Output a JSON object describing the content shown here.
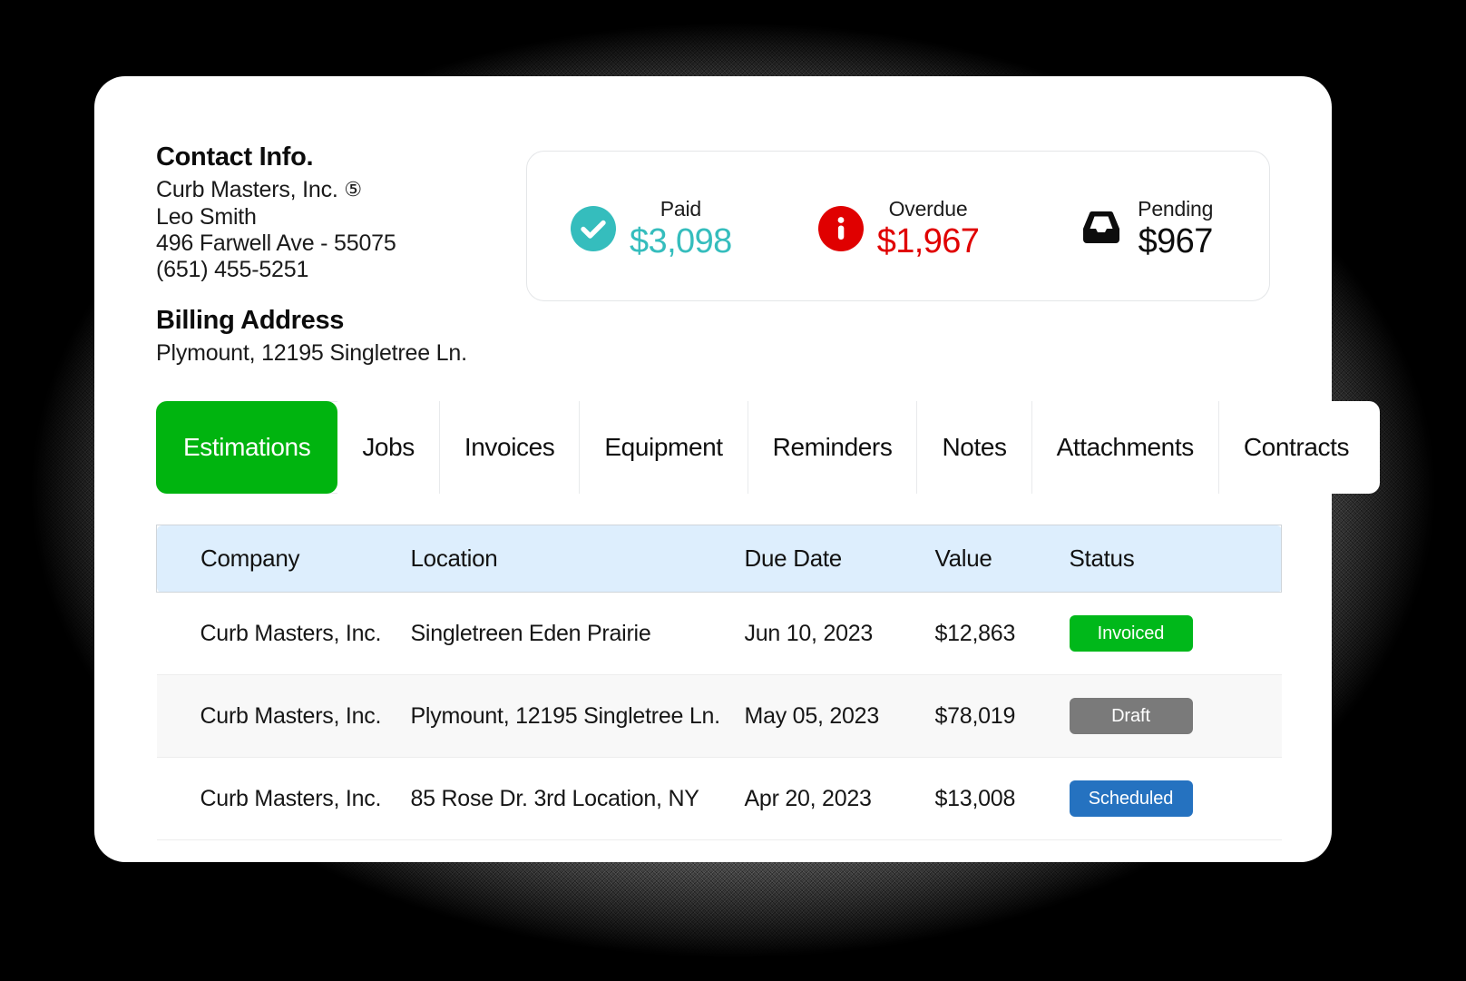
{
  "contact": {
    "title": "Contact Info.",
    "company": "Curb Masters, Inc.",
    "company_badge": "⑤",
    "person": "Leo Smith",
    "address": "496 Farwell Ave - 55075",
    "phone": "(651) 455-5251"
  },
  "billing": {
    "title": "Billing Address",
    "address": "Plymount, 12195 Singletree Ln."
  },
  "stats": [
    {
      "label": "Paid",
      "value": "$3,098",
      "icon": "check-circle-icon",
      "color": "#35bdbd"
    },
    {
      "label": "Overdue",
      "value": "$1,967",
      "icon": "info-circle-icon",
      "color": "#e00000"
    },
    {
      "label": "Pending",
      "value": "$967",
      "icon": "inbox-icon",
      "color": "#0d0d0d"
    }
  ],
  "tabs": [
    {
      "label": "Estimations",
      "active": true
    },
    {
      "label": "Jobs",
      "active": false
    },
    {
      "label": "Invoices",
      "active": false
    },
    {
      "label": "Equipment",
      "active": false
    },
    {
      "label": "Reminders",
      "active": false
    },
    {
      "label": "Notes",
      "active": false
    },
    {
      "label": "Attachments",
      "active": false
    },
    {
      "label": "Contracts",
      "active": false
    }
  ],
  "table": {
    "columns": [
      "Company",
      "Location",
      "Due Date",
      "Value",
      "Status"
    ],
    "rows": [
      {
        "company": "Curb Masters, Inc.",
        "location": "Singletreen Eden Prairie",
        "due_date": "Jun 10, 2023",
        "value": "$12,863",
        "status": "Invoiced",
        "status_color": "#00b81a"
      },
      {
        "company": "Curb Masters, Inc.",
        "location": "Plymount, 12195 Singletree Ln.",
        "due_date": "May 05, 2023",
        "value": "$78,019",
        "status": "Draft",
        "status_color": "#7a7a7a"
      },
      {
        "company": "Curb Masters, Inc.",
        "location": "85 Rose Dr. 3rd Location, NY",
        "due_date": "Apr 20, 2023",
        "value": "$13,008",
        "status": "Scheduled",
        "status_color": "#2572c0"
      }
    ]
  },
  "theme": {
    "active_tab_bg": "#00b40f",
    "table_header_bg": "#ddeefd",
    "card_bg": "#ffffff"
  }
}
